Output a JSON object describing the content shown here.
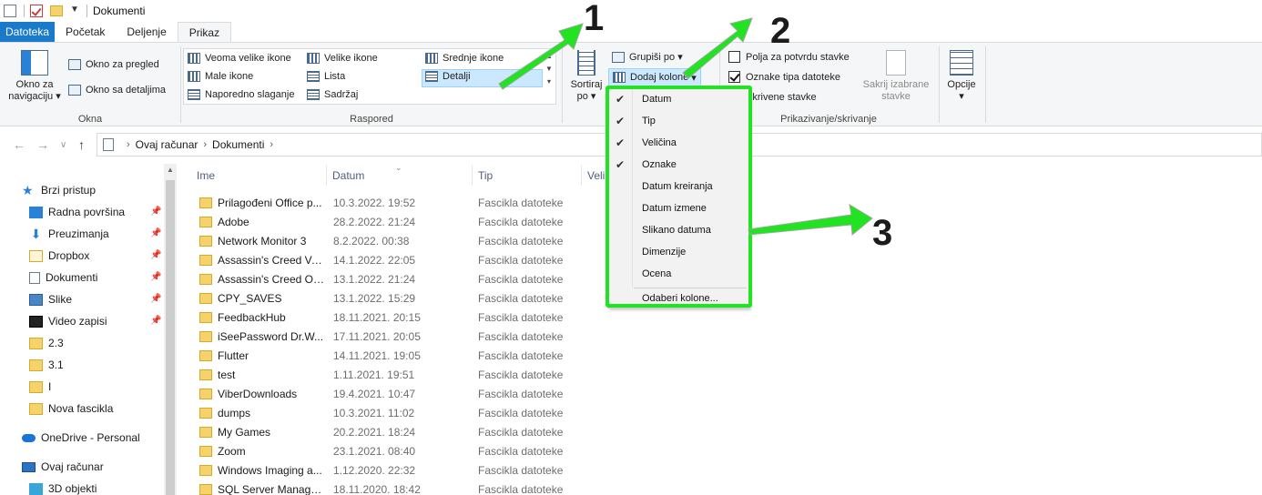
{
  "window": {
    "title": "Dokumenti"
  },
  "tabs": [
    {
      "label": "Datoteka"
    },
    {
      "label": "Početak"
    },
    {
      "label": "Deljenje"
    },
    {
      "label": "Prikaz"
    }
  ],
  "ribbon": {
    "okna": {
      "label": "Okna",
      "nav_pane": "Okno za navigaciju",
      "preview_pane": "Okno za pregled",
      "details_pane": "Okno sa detaljima"
    },
    "raspored": {
      "label": "Raspored",
      "items": [
        "Veoma velike ikone",
        "Velike ikone",
        "Srednje ikone",
        "Male ikone",
        "Lista",
        "Detalji",
        "Naporedno slaganje",
        "Sadržaj"
      ],
      "selected": "Detalji"
    },
    "trenutni_prikaz": {
      "sort": "Sortiraj po",
      "group": "Grupiši po",
      "add_columns": "Dodaj kolone"
    },
    "prikazivanje": {
      "label": "Prikazivanje/skrivanje",
      "checkboxes": [
        {
          "label": "Polja za potvrdu stavke",
          "checked": false
        },
        {
          "label": "Oznake tipa datoteke",
          "checked": true
        },
        {
          "label": "Skrivene stavke",
          "checked": false
        }
      ],
      "hide_selected": "Sakrij izabrane stavke"
    },
    "options": "Opcije"
  },
  "address": {
    "parts": [
      "Ovaj računar",
      "Dokumenti"
    ]
  },
  "navpane": {
    "items": [
      {
        "label": "Brzi pristup",
        "icon": "star-icon"
      },
      {
        "label": "Radna površina",
        "icon": "desktop-icon",
        "pinned": true
      },
      {
        "label": "Preuzimanja",
        "icon": "download-icon",
        "pinned": true
      },
      {
        "label": "Dropbox",
        "icon": "dropbox-icon",
        "pinned": true
      },
      {
        "label": "Dokumenti",
        "icon": "documents-icon",
        "pinned": true
      },
      {
        "label": "Slike",
        "icon": "pictures-icon",
        "pinned": true
      },
      {
        "label": "Video zapisi",
        "icon": "videos-icon",
        "pinned": true
      },
      {
        "label": "2.3",
        "icon": "folder-icon"
      },
      {
        "label": "3.1",
        "icon": "folder-icon"
      },
      {
        "label": "I",
        "icon": "folder-icon"
      },
      {
        "label": "Nova fascikla",
        "icon": "folder-icon"
      },
      {
        "label": "OneDrive - Personal",
        "icon": "cloud-icon"
      },
      {
        "label": "Ovaj računar",
        "icon": "computer-icon"
      },
      {
        "label": "3D objekti",
        "icon": "cube-icon"
      }
    ]
  },
  "filelist": {
    "columns": [
      "Ime",
      "Datum",
      "Tip",
      "Veli"
    ],
    "rows": [
      {
        "name": "Prilagođeni Office p...",
        "date": "10.3.2022. 19:52",
        "type": "Fascikla datoteke"
      },
      {
        "name": "Adobe",
        "date": "28.2.2022. 21:24",
        "type": "Fascikla datoteke"
      },
      {
        "name": "Network Monitor 3",
        "date": "8.2.2022. 00:38",
        "type": "Fascikla datoteke"
      },
      {
        "name": "Assassin's Creed Val...",
        "date": "14.1.2022. 22:05",
        "type": "Fascikla datoteke"
      },
      {
        "name": "Assassin's Creed Od...",
        "date": "13.1.2022. 21:24",
        "type": "Fascikla datoteke"
      },
      {
        "name": "CPY_SAVES",
        "date": "13.1.2022. 15:29",
        "type": "Fascikla datoteke"
      },
      {
        "name": "FeedbackHub",
        "date": "18.11.2021. 20:15",
        "type": "Fascikla datoteke"
      },
      {
        "name": "iSeePassword Dr.W...",
        "date": "17.11.2021. 20:05",
        "type": "Fascikla datoteke"
      },
      {
        "name": "Flutter",
        "date": "14.11.2021. 19:05",
        "type": "Fascikla datoteke"
      },
      {
        "name": "test",
        "date": "1.11.2021. 19:51",
        "type": "Fascikla datoteke"
      },
      {
        "name": "ViberDownloads",
        "date": "19.4.2021. 10:47",
        "type": "Fascikla datoteke"
      },
      {
        "name": "dumps",
        "date": "10.3.2021. 11:02",
        "type": "Fascikla datoteke"
      },
      {
        "name": "My Games",
        "date": "20.2.2021. 18:24",
        "type": "Fascikla datoteke"
      },
      {
        "name": "Zoom",
        "date": "23.1.2021. 08:40",
        "type": "Fascikla datoteke"
      },
      {
        "name": "Windows Imaging a...",
        "date": "1.12.2020. 22:32",
        "type": "Fascikla datoteke"
      },
      {
        "name": "SQL Server Manage...",
        "date": "18.11.2020. 18:42",
        "type": "Fascikla datoteke"
      }
    ]
  },
  "column_menu": {
    "items": [
      {
        "label": "Datum",
        "checked": true
      },
      {
        "label": "Tip",
        "checked": true
      },
      {
        "label": "Veličina",
        "checked": true
      },
      {
        "label": "Oznake",
        "checked": true
      },
      {
        "label": "Datum kreiranja",
        "checked": false
      },
      {
        "label": "Datum izmene",
        "checked": false
      },
      {
        "label": "Slikano datuma",
        "checked": false
      },
      {
        "label": "Dimenzije",
        "checked": false
      },
      {
        "label": "Ocena",
        "checked": false
      }
    ],
    "more": "Odaberi kolone..."
  },
  "annotations": [
    "1",
    "2",
    "3"
  ],
  "colors": {
    "accent": "#1979ca",
    "highlight": "#21e321",
    "folder": "#f6d36a"
  }
}
